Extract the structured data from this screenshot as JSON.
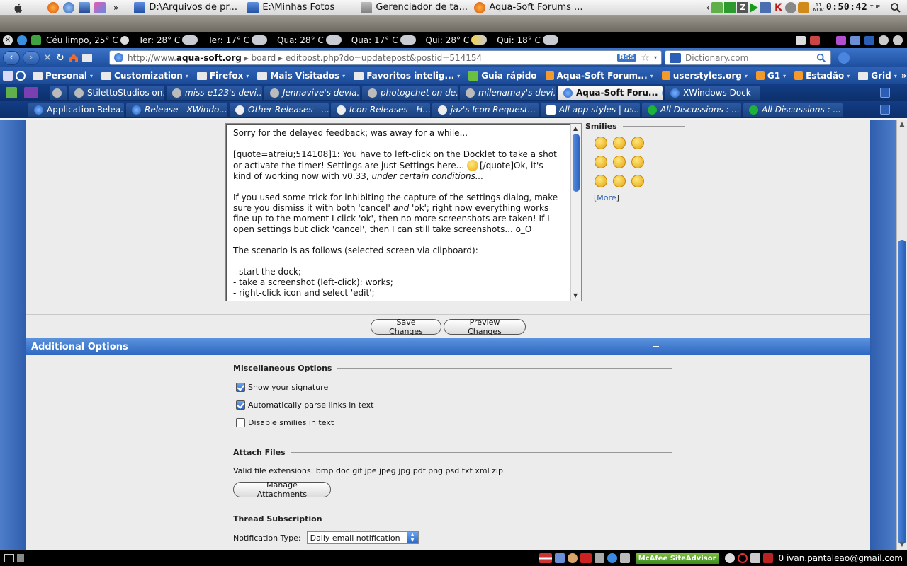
{
  "taskbar": {
    "tasks": [
      {
        "label": "D:\\Arquivos de pr..."
      },
      {
        "label": "E:\\Minhas Fotos"
      },
      {
        "label": "Gerenciador de ta..."
      },
      {
        "label": "Aqua-Soft Forums ..."
      }
    ],
    "date_day": "11",
    "date_month": "NOV",
    "time": "0:50:42",
    "weekday": "TUE"
  },
  "weather": {
    "items": [
      {
        "label": "Céu limpo, 25° C"
      },
      {
        "label": "Ter: 28° C"
      },
      {
        "label": "Ter: 17° C"
      },
      {
        "label": "Qua: 28° C"
      },
      {
        "label": "Qua: 17° C"
      },
      {
        "label": "Qui: 28° C"
      },
      {
        "label": "Qui: 18° C"
      }
    ]
  },
  "nav": {
    "url_prefix": "http://www.",
    "url_domain": "aqua-soft.org",
    "url_path": " ▸ board ▸ editpost.php?do=updatepost&postid=514154",
    "rss": "RSS",
    "search_placeholder": "Dictionary.com"
  },
  "bookmarks": [
    {
      "label": "Personal"
    },
    {
      "label": "Customization"
    },
    {
      "label": "Firefox"
    },
    {
      "label": "Mais Visitados"
    },
    {
      "label": "Favoritos intelig..."
    },
    {
      "label": "Guia rápido"
    },
    {
      "label": "Aqua-Soft Forum..."
    },
    {
      "label": "userstyles.org"
    },
    {
      "label": "G1"
    },
    {
      "label": "Estadão"
    },
    {
      "label": "Grid"
    }
  ],
  "tabs_row1": [
    {
      "label": "StilettoStudios on..."
    },
    {
      "label": "miss-e123's devi..."
    },
    {
      "label": "Jennavive's devia..."
    },
    {
      "label": "photogchet on de..."
    },
    {
      "label": "milenamay's devi..."
    },
    {
      "label": "Aqua-Soft Foru..."
    },
    {
      "label": "XWindows Dock - ..."
    }
  ],
  "tabs_row2": [
    {
      "label": "Application Relea..."
    },
    {
      "label": "Release - XWindo..."
    },
    {
      "label": "Other Releases - ..."
    },
    {
      "label": "Icon Releases - H..."
    },
    {
      "label": "jaz's Icon Request..."
    },
    {
      "label": "All app styles | us..."
    },
    {
      "label": "All Discussions : ..."
    },
    {
      "label": "All Discussions : ..."
    }
  ],
  "editor": {
    "p1": "Sorry for the delayed feedback; was away for a while...",
    "p2a": "[quote=atreiu;514108]1: You have to left-click on the Docklet to take a shot or activate the timer! Settings are just Settings here...",
    "p2b": "[/quote]Ok, it's kind of working now with v0.33,",
    "p2c": "under certain conditions...",
    "p3a": "If you used some trick for inhibiting the capture of the settings dialog, make sure you dismiss it with both 'cancel'",
    "p3b": "and",
    "p3c": "'ok'; right now everything works fine up to the moment I click 'ok', then no more screenshots are taken! If I open settings but click 'cancel', then I can still take screenshots... o_O",
    "p4": "The scenario is as follows (selected screen via clipboard):",
    "list": [
      "- start the dock;",
      "- take a screenshot (left-click): works;",
      "- right-click icon and select 'edit';"
    ]
  },
  "smilies": {
    "title": "Smilies",
    "more_bracket_l": "[",
    "more": "More",
    "more_bracket_r": "]"
  },
  "buttons": {
    "save": "Save Changes",
    "preview": "Preview Changes",
    "manage_attachments": "Manage Attachments"
  },
  "additional": {
    "title": "Additional Options",
    "collapse": "−"
  },
  "misc": {
    "title": "Miscellaneous Options",
    "options": [
      {
        "label": "Show your signature",
        "checked": true
      },
      {
        "label": "Automatically parse links in text",
        "checked": true
      },
      {
        "label": "Disable smilies in text",
        "checked": false
      }
    ]
  },
  "attach": {
    "title": "Attach Files",
    "extensions": "Valid file extensions: bmp doc gif jpe jpeg jpg pdf png psd txt xml zip"
  },
  "thread": {
    "title": "Thread Subscription",
    "notif_label": "Notification Type:",
    "notif_value": "Daily email notification"
  },
  "statusbar": {
    "mcafee": "McAfee SiteAdvisor",
    "mail": "0 ivan.pantaleao@gmail.com"
  }
}
